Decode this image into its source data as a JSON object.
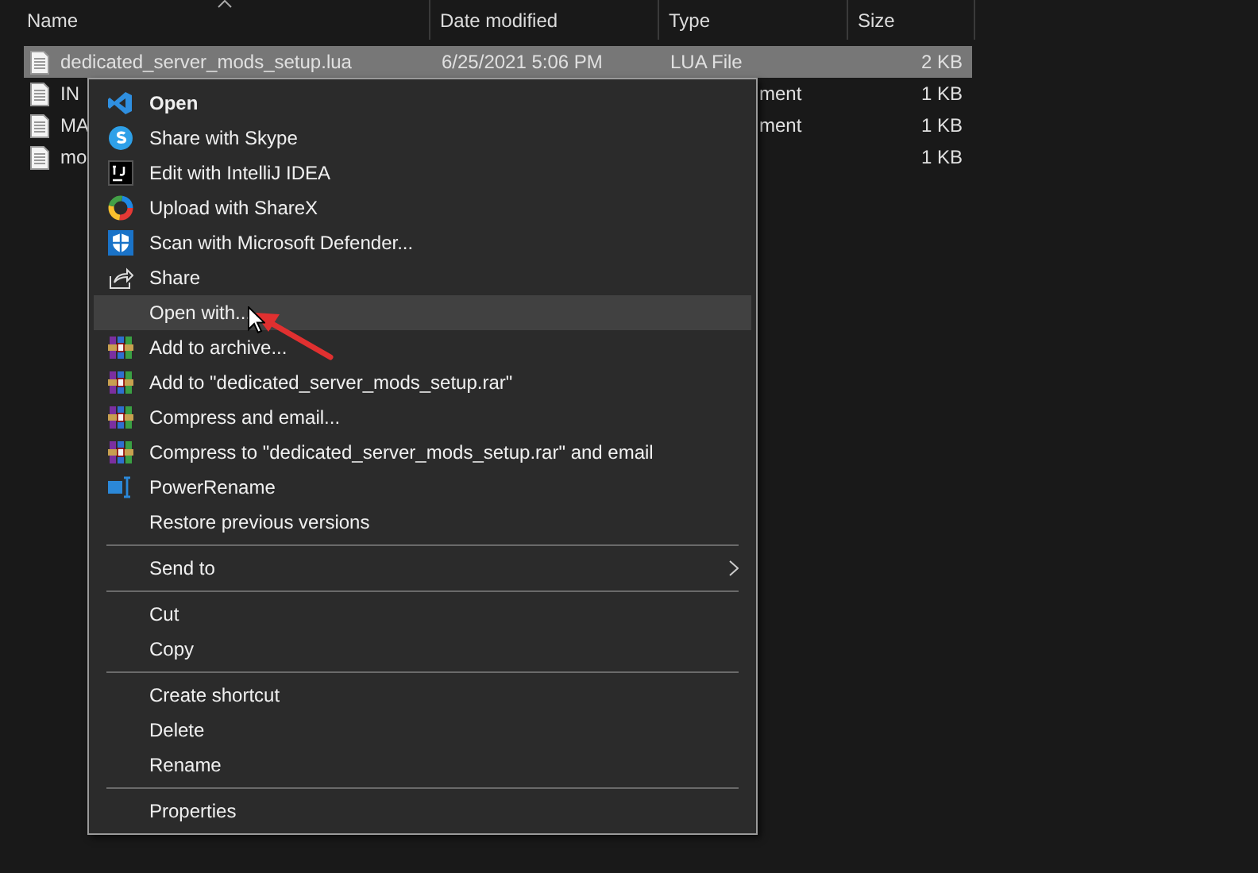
{
  "columns": [
    {
      "label": "Name",
      "sorted": true
    },
    {
      "label": "Date modified",
      "sorted": false
    },
    {
      "label": "Type",
      "sorted": false
    },
    {
      "label": "Size",
      "sorted": false
    }
  ],
  "rows": [
    {
      "name": "dedicated_server_mods_setup.lua",
      "date": "6/25/2021 5:06 PM",
      "type": "LUA File",
      "size": "2 KB",
      "selected": true
    },
    {
      "name": "IN",
      "type": "ment",
      "size": "1 KB",
      "selected": false
    },
    {
      "name": "MA",
      "type": "ment",
      "size": "1 KB",
      "selected": false
    },
    {
      "name": "mo",
      "size": "1 KB",
      "selected": false
    }
  ],
  "context_menu": {
    "sections": [
      [
        {
          "label": "Open",
          "default": true,
          "selected": false,
          "submenu": false
        },
        {
          "label": "Share with Skype",
          "default": false,
          "selected": false,
          "submenu": false
        },
        {
          "label": "Edit with IntelliJ IDEA",
          "default": false,
          "selected": false,
          "submenu": false
        },
        {
          "label": "Upload with ShareX",
          "default": false,
          "selected": false,
          "submenu": false
        },
        {
          "label": "Scan with Microsoft Defender...",
          "default": false,
          "selected": false,
          "submenu": false
        },
        {
          "label": "Share",
          "default": false,
          "selected": false,
          "submenu": false
        },
        {
          "label": "Open with...",
          "default": false,
          "selected": true,
          "submenu": false
        },
        {
          "label": "Add to archive...",
          "default": false,
          "selected": false,
          "submenu": false
        },
        {
          "label": "Add to \"dedicated_server_mods_setup.rar\"",
          "default": false,
          "selected": false,
          "submenu": false
        },
        {
          "label": "Compress and email...",
          "default": false,
          "selected": false,
          "submenu": false
        },
        {
          "label": "Compress to \"dedicated_server_mods_setup.rar\" and email",
          "default": false,
          "selected": false,
          "submenu": false
        },
        {
          "label": "PowerRename",
          "default": false,
          "selected": false,
          "submenu": false
        },
        {
          "label": "Restore previous versions",
          "default": false,
          "selected": false,
          "submenu": false
        }
      ],
      [
        {
          "label": "Send to",
          "default": false,
          "selected": false,
          "submenu": true
        }
      ],
      [
        {
          "label": "Cut",
          "default": false,
          "selected": false,
          "submenu": false
        },
        {
          "label": "Copy",
          "default": false,
          "selected": false,
          "submenu": false
        }
      ],
      [
        {
          "label": "Create shortcut",
          "default": false,
          "selected": false,
          "submenu": false
        },
        {
          "label": "Delete",
          "default": false,
          "selected": false,
          "submenu": false
        },
        {
          "label": "Rename",
          "default": false,
          "selected": false,
          "submenu": false
        }
      ],
      [
        {
          "label": "Properties",
          "default": false,
          "selected": false,
          "submenu": false
        }
      ]
    ]
  }
}
